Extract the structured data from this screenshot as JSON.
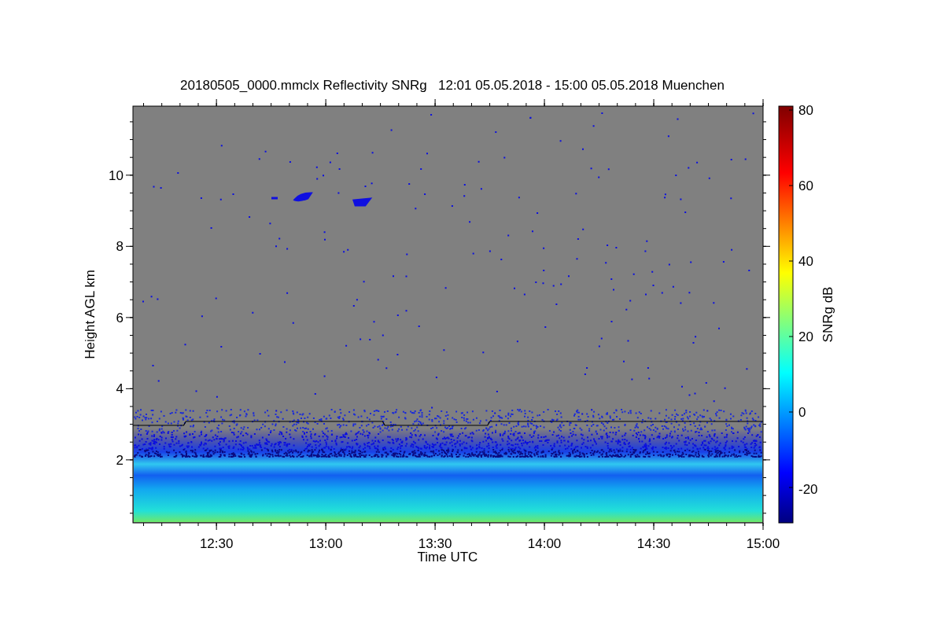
{
  "plot": {
    "title": "20180505_0000.mmclx Reflectivity SNRg   12:01 05.05.2018 - 15:00 05.05.2018 Muenchen",
    "chart_data": {
      "type": "line",
      "xlabel": "Time UTC",
      "ylabel": "Height AGL km",
      "xlim": [
        12.118,
        15.0
      ],
      "ylim": [
        0.23,
        11.94
      ],
      "x": [
        12.118,
        12.35,
        12.36,
        13.26,
        13.27,
        13.74,
        13.75,
        15.0
      ],
      "series": [
        {
          "color": "#000000",
          "values": [
            2.97,
            2.97,
            3.08,
            3.08,
            2.97,
            2.97,
            3.08,
            3.08
          ]
        }
      ],
      "xticks": [
        {
          "value": 12.5,
          "label": "12:30"
        },
        {
          "value": 13.0,
          "label": "13:00"
        },
        {
          "value": 13.5,
          "label": "13:30"
        },
        {
          "value": 14.0,
          "label": "14:00"
        },
        {
          "value": 14.5,
          "label": "14:30"
        },
        {
          "value": 15.0,
          "label": "15:00"
        }
      ],
      "yticks": [
        2,
        4,
        6,
        8,
        10
      ]
    }
  },
  "colorbar": {
    "label": "SNRg dB",
    "ticks": [
      "80",
      "60",
      "40",
      "20",
      "0",
      "-20"
    ]
  }
}
